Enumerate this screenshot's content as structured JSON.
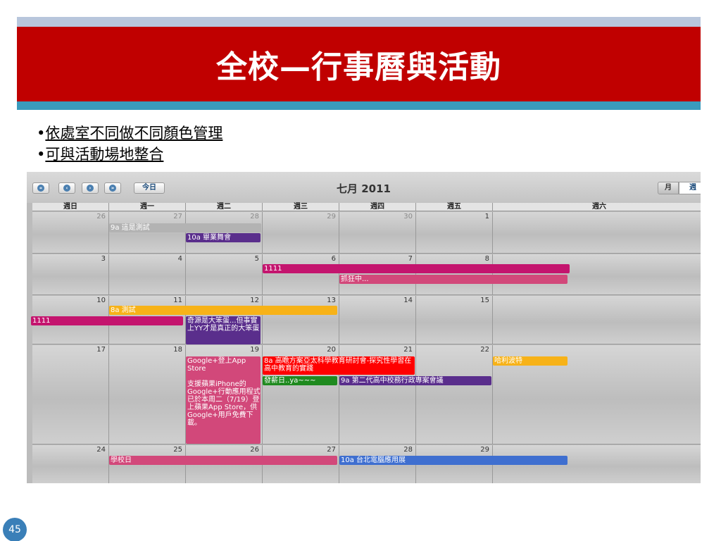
{
  "slide": {
    "title": "全校—行事曆與活動",
    "bullets": [
      "依處室不同做不同顏色管理",
      "可與活動場地整合"
    ],
    "bullet_marker": "•",
    "page_number": "45"
  },
  "calendar": {
    "toolbar": {
      "nav_icons": [
        "prev-year-icon",
        "prev-month-icon",
        "next-month-icon",
        "next-year-icon"
      ],
      "nav_glyphs": [
        "«",
        "‹",
        "›",
        "»"
      ],
      "today_label": "今日",
      "month_title": "七月 2011",
      "view_month_label": "月",
      "view_week_label": "週"
    },
    "weekdays": [
      "週日",
      "週一",
      "週二",
      "週三",
      "週四",
      "週五",
      "週六"
    ],
    "weeks": [
      {
        "days": [
          "26",
          "27",
          "28",
          "29",
          "30",
          "1",
          ""
        ],
        "events": [
          {
            "label": "9a 這是測試",
            "color": "#b3b3b3"
          },
          {
            "label": "10a 畢業舞會",
            "color": "#5a2e8c"
          }
        ]
      },
      {
        "days": [
          "3",
          "4",
          "5",
          "6",
          "7",
          "8",
          ""
        ],
        "events": [
          {
            "label": "1111",
            "color": "#c4146e"
          },
          {
            "label": "抓狂中...",
            "color": "#d2487a"
          }
        ]
      },
      {
        "days": [
          "10",
          "11",
          "12",
          "13",
          "14",
          "15",
          ""
        ],
        "events": [
          {
            "label": "8a 測試",
            "color": "#f7b218"
          },
          {
            "label": "1111",
            "color": "#c4146e"
          },
          {
            "label": "奇源是大笨蛋...但事實上YY才是真正的大笨蛋",
            "color": "#5a2e8c"
          }
        ]
      },
      {
        "days": [
          "17",
          "18",
          "19",
          "20",
          "21",
          "22",
          ""
        ],
        "events": [
          {
            "label": "Google+登上App Store\n\n支援蘋果iPhone的Google+行動應用程式已於本周二（7/19）登上蘋果App Store，供Google+用戶免費下載。",
            "color": "#d2487a"
          },
          {
            "label": "8a 高瞻方案亞太科學教育研討會-探究性學習在高中教育的實踐",
            "color": "#ff0000"
          },
          {
            "label": "發薪日..ya~~~",
            "color": "#1f8a1f"
          },
          {
            "label": "9a 第二代高中校務行政專案會議",
            "color": "#5a2e8c"
          },
          {
            "label": "哈利波特",
            "color": "#f7b218"
          }
        ]
      },
      {
        "days": [
          "24",
          "25",
          "26",
          "27",
          "28",
          "29",
          ""
        ],
        "events": [
          {
            "label": "學校日",
            "color": "#d2487a"
          },
          {
            "label": "10a 台北電腦應用展",
            "color": "#3f6fd0"
          }
        ]
      }
    ]
  }
}
